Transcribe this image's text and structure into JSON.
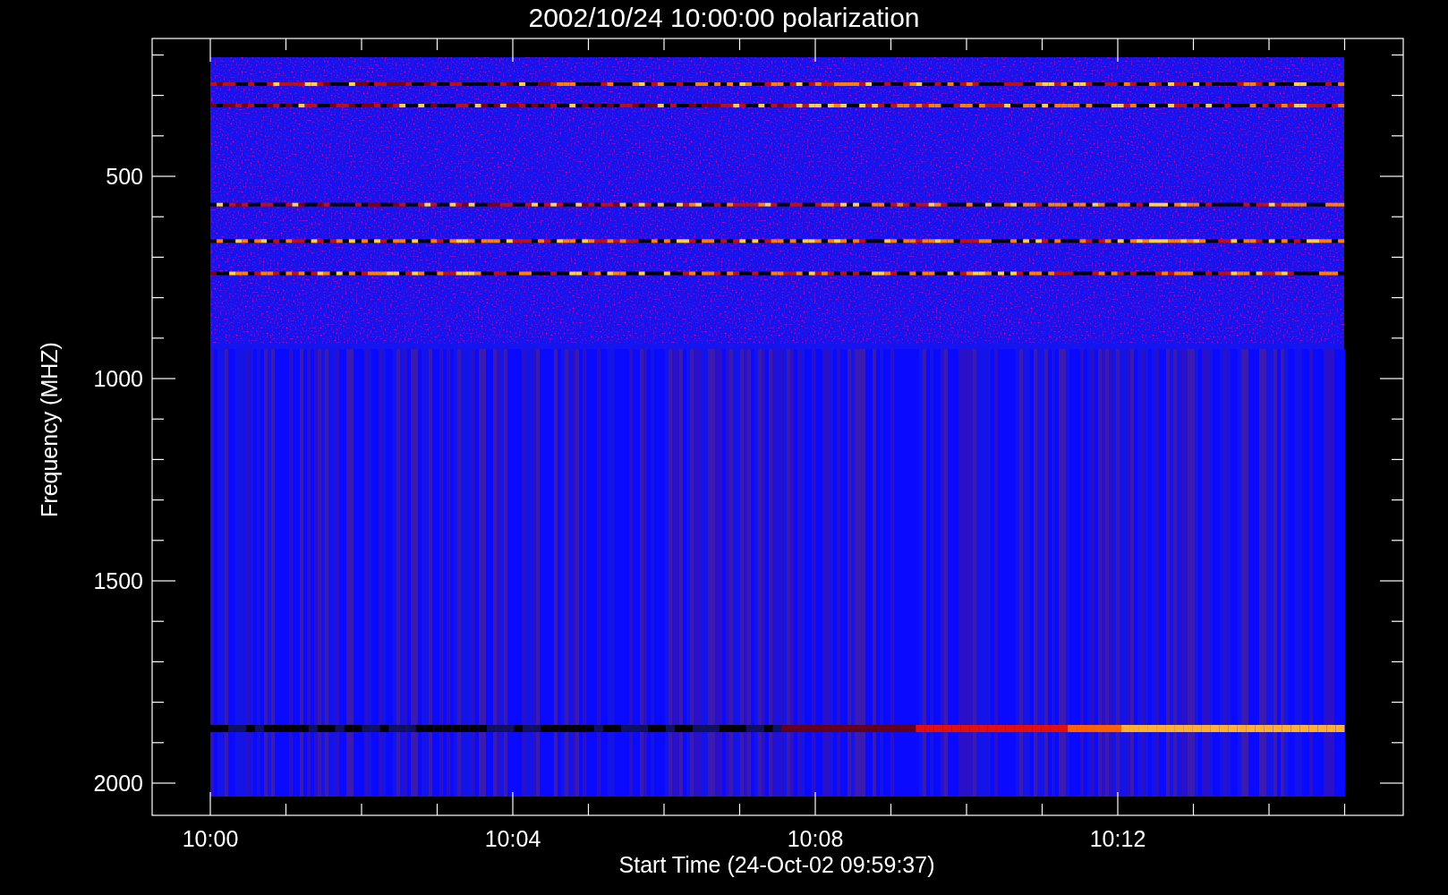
{
  "title": "2002/10/24 10:00:00 polarization",
  "x_axis": {
    "label": "Start Time (24-Oct-02 09:59:37)",
    "ticks": [
      "10:00",
      "10:04",
      "10:08",
      "10:12"
    ]
  },
  "y_axis": {
    "label": "Frequency (MHZ)",
    "ticks": [
      "500",
      "1000",
      "1500",
      "2000"
    ]
  }
}
